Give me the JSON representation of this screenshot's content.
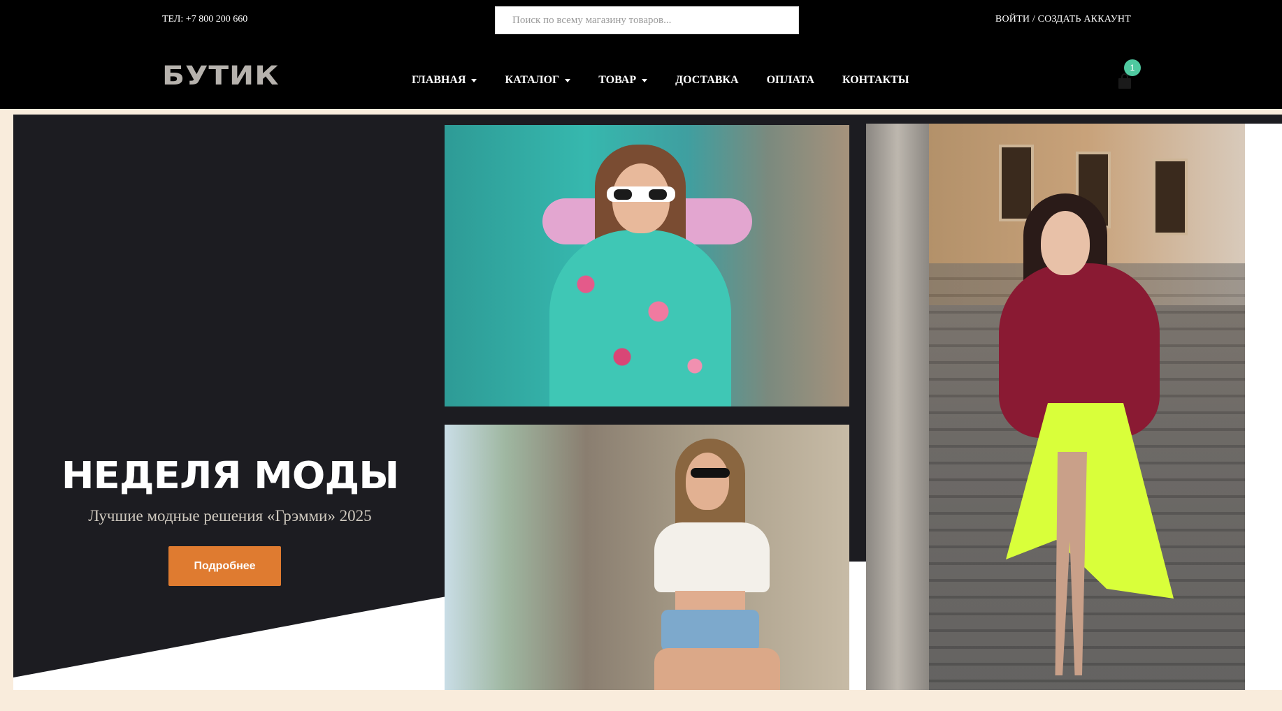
{
  "header": {
    "phone": "ТЕЛ: +7 800 200 660",
    "search_placeholder": "Поиск по всему магазину товаров...",
    "account_link": "ВОЙТИ / СОЗДАТЬ АККАУНТ",
    "logo": "БУТИК",
    "cart_count": "1"
  },
  "nav": {
    "items": [
      {
        "label": "ГЛАВНАЯ",
        "dropdown": true
      },
      {
        "label": "КАТАЛОГ",
        "dropdown": true
      },
      {
        "label": "ТОВАР",
        "dropdown": true
      },
      {
        "label": "ДОСТАВКА",
        "dropdown": false
      },
      {
        "label": "ОПЛАТА",
        "dropdown": false
      },
      {
        "label": "КОНТАКТЫ",
        "dropdown": false
      }
    ]
  },
  "hero": {
    "title": "НЕДЕЛЯ МОДЫ",
    "subtitle": "Лучшие модные решения «Грэмми» 2025",
    "button_label": "Подробнее",
    "slides": 4,
    "active_slide": 1
  },
  "colors": {
    "header_bg": "#000000",
    "hero_bg": "#1c1c21",
    "accent": "#df7b30",
    "badge": "#4fc9a0",
    "page_bg": "#f9ecdc"
  }
}
